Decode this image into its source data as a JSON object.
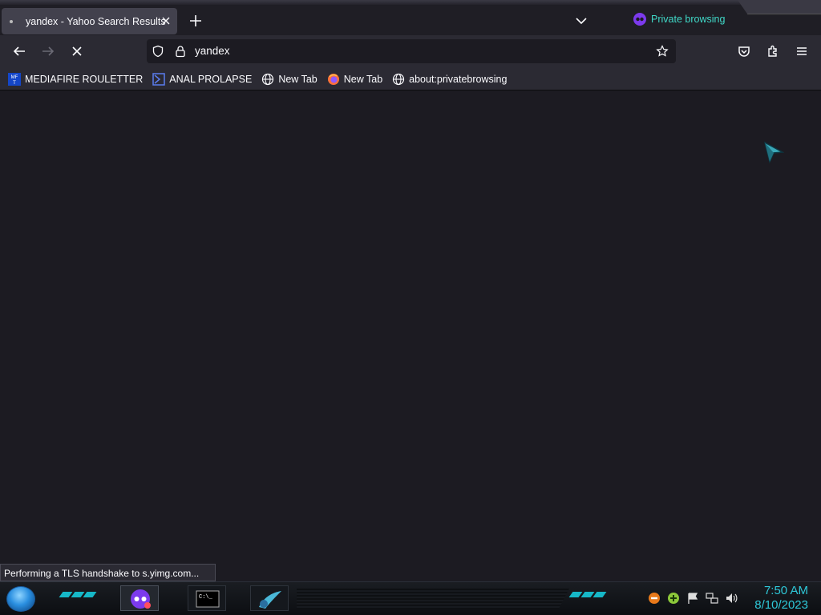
{
  "browser": {
    "tab_title": "yandex - Yahoo Search Results",
    "private_label": "Private browsing",
    "url": "yandex",
    "status_text": "Performing a TLS handshake to s.yimg.com..."
  },
  "bookmarks": [
    {
      "label": "MEDIAFIRE ROULETTER",
      "icon": "mediafire-icon"
    },
    {
      "label": "ANAL PROLAPSE",
      "icon": "bookmark-sigma-icon"
    },
    {
      "label": "New Tab",
      "icon": "globe-icon"
    },
    {
      "label": "New Tab",
      "icon": "firefox-icon"
    },
    {
      "label": "about:privatebrowsing",
      "icon": "globe-icon"
    }
  ],
  "taskbar": {
    "time": "7:50 AM",
    "date": "8/10/2023"
  },
  "colors": {
    "accent": "#40d9c8",
    "chrome_bg": "#2b2a33",
    "content_bg": "#1c1b22",
    "private_purple": "#7c3aed",
    "clock": "#2ec8d8"
  }
}
